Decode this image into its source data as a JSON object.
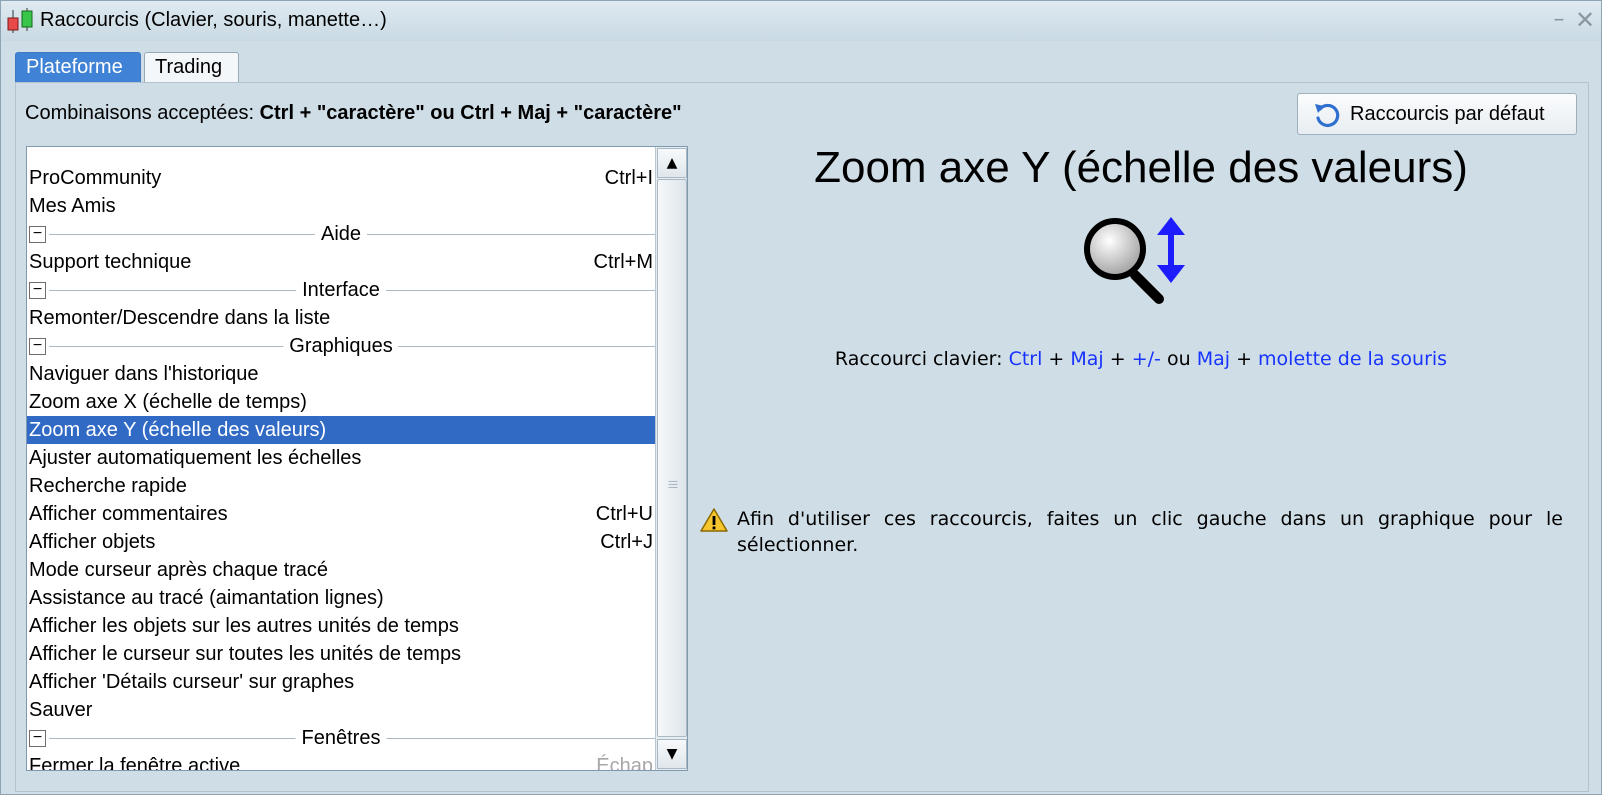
{
  "window": {
    "title": "Raccourcis (Clavier, souris, manette…)",
    "minimize_glyph": "–",
    "close_glyph": "✕"
  },
  "tabs": [
    {
      "label": "Plateforme",
      "active": true
    },
    {
      "label": "Trading",
      "active": false
    }
  ],
  "hint": {
    "prefix": "Combinaisons acceptées: ",
    "combos": "Ctrl + \"caractère\" ou Ctrl + Maj + \"caractère\""
  },
  "reset_button": {
    "label": "Raccourcis par défaut",
    "icon": "undo-icon"
  },
  "list": {
    "rows": [
      {
        "type": "item",
        "label": "ProCommunity",
        "shortcut": "Ctrl+I"
      },
      {
        "type": "item",
        "label": "Mes Amis",
        "shortcut": ""
      },
      {
        "type": "group",
        "label": "Aide"
      },
      {
        "type": "item",
        "label": "Support technique",
        "shortcut": "Ctrl+M"
      },
      {
        "type": "group",
        "label": "Interface"
      },
      {
        "type": "item",
        "label": "Remonter/Descendre dans la liste",
        "shortcut": ""
      },
      {
        "type": "group",
        "label": "Graphiques"
      },
      {
        "type": "item",
        "label": "Naviguer dans l'historique",
        "shortcut": ""
      },
      {
        "type": "item",
        "label": "Zoom axe X (échelle de temps)",
        "shortcut": ""
      },
      {
        "type": "item",
        "label": "Zoom axe Y (échelle des valeurs)",
        "shortcut": "",
        "selected": true
      },
      {
        "type": "item",
        "label": "Ajuster automatiquement les échelles",
        "shortcut": ""
      },
      {
        "type": "item",
        "label": "Recherche rapide",
        "shortcut": ""
      },
      {
        "type": "item",
        "label": "Afficher commentaires",
        "shortcut": "Ctrl+U"
      },
      {
        "type": "item",
        "label": "Afficher objets",
        "shortcut": "Ctrl+J"
      },
      {
        "type": "item",
        "label": "Mode curseur après chaque tracé",
        "shortcut": ""
      },
      {
        "type": "item",
        "label": "Assistance au tracé (aimantation lignes)",
        "shortcut": ""
      },
      {
        "type": "item",
        "label": "Afficher les objets sur les autres unités de temps",
        "shortcut": ""
      },
      {
        "type": "item",
        "label": "Afficher le curseur sur toutes les unités de temps",
        "shortcut": ""
      },
      {
        "type": "item",
        "label": "Afficher 'Détails curseur' sur graphes",
        "shortcut": ""
      },
      {
        "type": "item",
        "label": "Sauver",
        "shortcut": ""
      },
      {
        "type": "group",
        "label": "Fenêtres"
      },
      {
        "type": "item",
        "label": "Fermer la fenêtre active",
        "shortcut": "Échap",
        "dim": true
      }
    ],
    "collapse_glyph": "−",
    "scroll_up_glyph": "▲",
    "scroll_down_glyph": "▼"
  },
  "detail": {
    "title": "Zoom axe Y (échelle des valeurs)",
    "icon": "zoom-vertical-icon",
    "shortcut_label": "Raccourci clavier:",
    "keys": [
      "Ctrl",
      "Maj",
      "+/-",
      "Maj",
      "molette de la souris"
    ],
    "plus": "+",
    "or": "ou",
    "warning_icon": "warning-icon",
    "warning_text": "Afin d'utiliser ces raccourcis, faites un clic gauche dans un graphique pour le sélectionner."
  },
  "colors": {
    "accent": "#3f82d6",
    "selection": "#316ac5",
    "key_text": "#1733ff",
    "background": "#cfdde6"
  }
}
